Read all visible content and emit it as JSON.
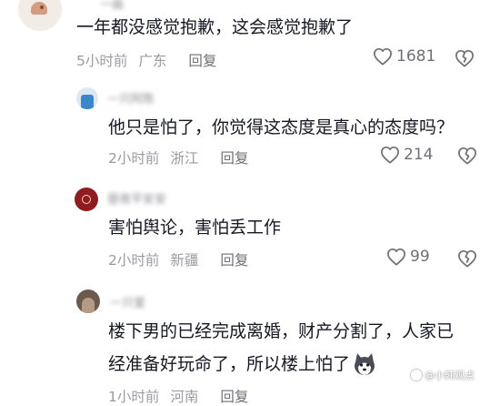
{
  "comments": [
    {
      "username": "一画",
      "text": "一年都没感觉抱歉，这会感觉抱歉了",
      "time": "5小时前",
      "location": "广东",
      "reply": "回复",
      "likes": "1681"
    },
    {
      "username": "一只阿陈",
      "text": "他只是怕了，你觉得这态度是真心的态度吗？",
      "time": "2小时前",
      "location": "浙江",
      "reply": "回复",
      "likes": "214"
    },
    {
      "username": "昼夜平安安",
      "text": "害怕舆论，害怕丢工作",
      "time": "2小时前",
      "location": "新疆",
      "reply": "回复",
      "likes": "99"
    },
    {
      "username": "一只爱",
      "text_line1": "楼下男的已经完成离婚，财产分割了，人家已",
      "text_line2": "经准备好玩命了，所以楼上怕了",
      "time": "1小时前",
      "location": "河南",
      "reply": "回复"
    }
  ],
  "watermark": "@小韩观点",
  "colors": {
    "text": "#161823",
    "meta": "#9a9ba1",
    "icon": "#6f7076",
    "bg": "#ffffff"
  },
  "icons": [
    "heart-outline-icon",
    "broken-heart-icon",
    "husky-emoji-icon"
  ]
}
